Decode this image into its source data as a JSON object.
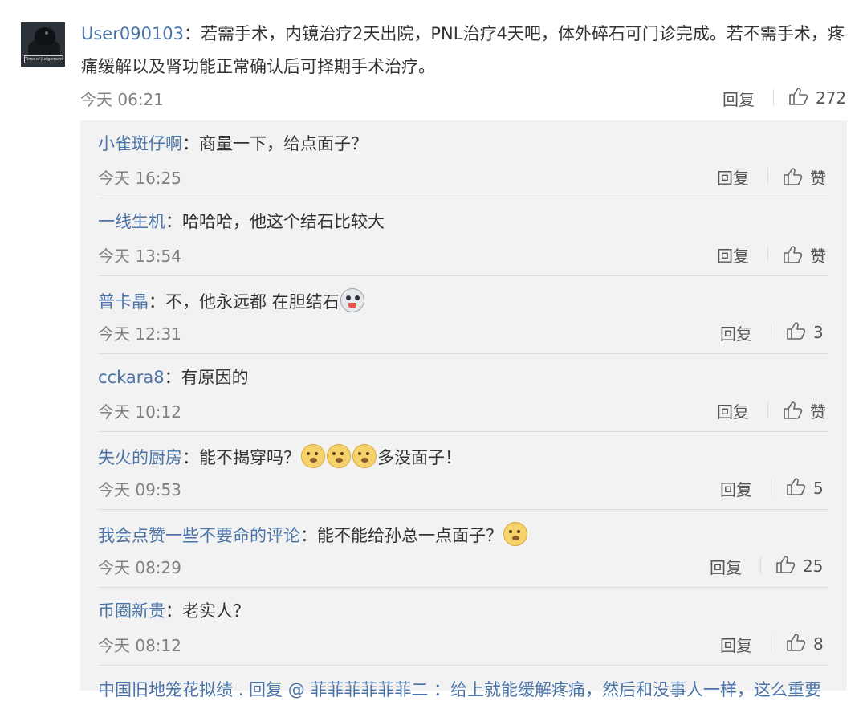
{
  "main_comment": {
    "username": "User090103",
    "separator": "：",
    "text": "若需手术，内镜治疗2天出院，PNL治疗4天吧，体外碎石可门诊完成。若不需手术，疼痛缓解以及肾功能正常确认后可择期手术治疗。",
    "time": "今天 06:21",
    "reply_label": "回复",
    "likes": "272",
    "avatar_caption": "Time of Judgement"
  },
  "replies": [
    {
      "username": "小雀斑仔啊",
      "text": "商量一下，给点面子？",
      "time": "今天 16:25",
      "reply_label": "回复",
      "likes": "赞"
    },
    {
      "username": "一线生机",
      "text": "哈哈哈，他这个结石比较大",
      "time": "今天 13:54",
      "reply_label": "回复",
      "likes": "赞"
    },
    {
      "username": "普卡晶",
      "text": "不，他永远都  在胆结石",
      "time": "今天 12:31",
      "reply_label": "回复",
      "likes": "3"
    },
    {
      "username": "cckara8",
      "text": "有原因的",
      "time": "今天 10:12",
      "reply_label": "回复",
      "likes": "赞"
    },
    {
      "username": "失火的厨房",
      "text": "能不揭穿吗？",
      "text_after": "多没面子！",
      "time": "今天 09:53",
      "reply_label": "回复",
      "likes": "5"
    },
    {
      "username": "我会点赞一些不要命的评论",
      "text": "能不能给孙总一点面子？",
      "time": "今天 08:29",
      "reply_label": "回复",
      "likes": "25"
    },
    {
      "username": "币圈新贵",
      "text": "老实人？",
      "time": "今天 08:12",
      "reply_label": "回复",
      "likes": "8"
    }
  ],
  "separator": "：",
  "cutoff_text": "中国旧地笼花拟绩 . 回复 @ 菲菲菲菲菲菲二 ：给上就能缓解疼痛，然后和没事人一样，这么重要"
}
